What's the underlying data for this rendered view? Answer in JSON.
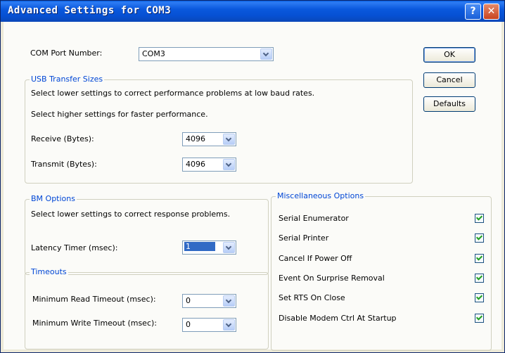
{
  "window": {
    "title": "Advanced Settings for COM3",
    "help_glyph": "?",
    "close_glyph": "✕"
  },
  "com_port": {
    "label": "COM Port Number:",
    "value": "COM3"
  },
  "buttons": {
    "ok": "OK",
    "cancel": "Cancel",
    "defaults": "Defaults"
  },
  "usb": {
    "title": "USB Transfer Sizes",
    "note_low": "Select lower settings to correct performance problems at low baud rates.",
    "note_high": "Select higher settings for faster performance.",
    "receive_label": "Receive (Bytes):",
    "receive_value": "4096",
    "transmit_label": "Transmit (Bytes):",
    "transmit_value": "4096"
  },
  "bm": {
    "title": "BM Options",
    "note": "Select lower settings to correct response problems.",
    "latency_label": "Latency Timer (msec):",
    "latency_value": "1"
  },
  "timeouts": {
    "title": "Timeouts",
    "read_label": "Minimum Read Timeout (msec):",
    "read_value": "0",
    "write_label": "Minimum Write Timeout (msec):",
    "write_value": "0"
  },
  "misc": {
    "title": "Miscellaneous Options",
    "options": [
      {
        "label": "Serial Enumerator",
        "checked": true
      },
      {
        "label": "Serial Printer",
        "checked": true
      },
      {
        "label": "Cancel If Power Off",
        "checked": true
      },
      {
        "label": "Event On Surprise Removal",
        "checked": true
      },
      {
        "label": "Set RTS On Close",
        "checked": true
      },
      {
        "label": "Disable Modem Ctrl At Startup",
        "checked": true
      }
    ]
  }
}
